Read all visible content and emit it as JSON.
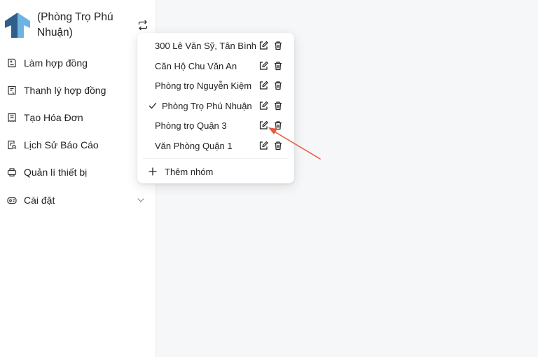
{
  "brand": {
    "title": "(Phòng Trọ Phú Nhuận)",
    "logo_colors": {
      "left": "#2f5f8a",
      "right": "#6fb3e0"
    }
  },
  "sidebar": {
    "items": [
      {
        "label": "Làm hợp đồng",
        "icon": "contract-icon"
      },
      {
        "label": "Thanh lý hợp đồng",
        "icon": "document-icon"
      },
      {
        "label": "Tạo Hóa Đơn",
        "icon": "invoice-icon"
      },
      {
        "label": "Lịch Sử Báo Cáo",
        "icon": "report-search-icon"
      },
      {
        "label": "Quản lí thiết bị",
        "icon": "device-icon"
      },
      {
        "label": "Cài đặt",
        "icon": "settings-icon",
        "has_submenu": true
      }
    ]
  },
  "group_menu": {
    "groups": [
      {
        "name": "300 Lê Văn Sỹ, Tân Bình",
        "selected": false
      },
      {
        "name": "Căn Hộ Chu Văn An",
        "selected": false
      },
      {
        "name": "Phòng trọ Nguyễn Kiệm",
        "selected": false
      },
      {
        "name": "Phòng Trọ Phú Nhuận",
        "selected": true
      },
      {
        "name": "Phòng trọ Quận 3",
        "selected": false
      },
      {
        "name": "Văn Phòng Quận 1",
        "selected": false
      }
    ],
    "add_label": "Thêm nhóm"
  },
  "annotation": {
    "color": "#e8583f"
  }
}
